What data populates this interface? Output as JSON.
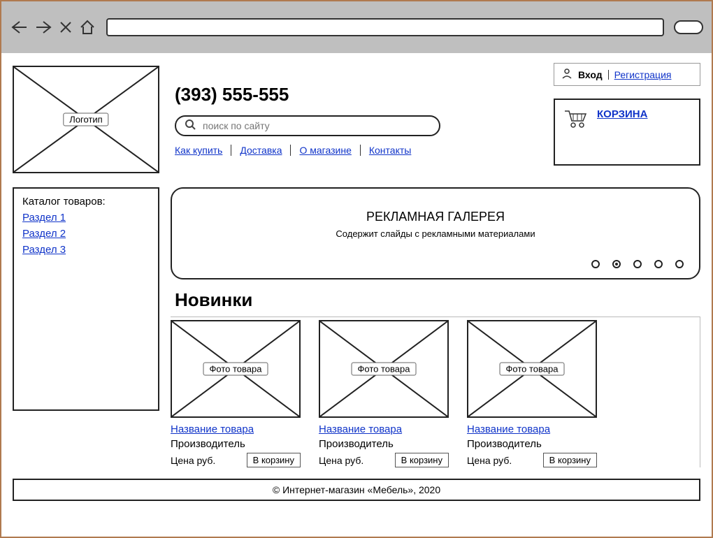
{
  "header": {
    "phone": "(393) 555-555",
    "search_placeholder": "поиск по сайту",
    "nav": [
      "Как купить",
      "Доставка",
      "О магазине",
      "Контакты"
    ]
  },
  "auth": {
    "login": "Вход",
    "register": "Регистрация"
  },
  "cart": {
    "label": "КОРЗИНА"
  },
  "logo_caption": "Логотип",
  "catalog": {
    "title": "Каталог товаров:",
    "items": [
      "Раздел 1",
      "Раздел 2",
      "Раздел 3"
    ]
  },
  "gallery": {
    "title": "РЕКЛАМНАЯ ГАЛЕРЕЯ",
    "subtitle": "Содержит слайды с рекламными материалами",
    "active_dot": 1,
    "dot_count": 5
  },
  "section_title": "Новинки",
  "product_photo_caption": "Фото товара",
  "products": [
    {
      "name": "Название товара",
      "manufacturer": "Производитель",
      "price": "Цена руб.",
      "button": "В корзину"
    },
    {
      "name": "Название товара",
      "manufacturer": "Производитель",
      "price": "Цена руб.",
      "button": "В корзину"
    },
    {
      "name": "Название товара",
      "manufacturer": "Производитель",
      "price": "Цена руб.",
      "button": "В корзину"
    }
  ],
  "footer": "© Интернет-магазин «Мебель», 2020"
}
